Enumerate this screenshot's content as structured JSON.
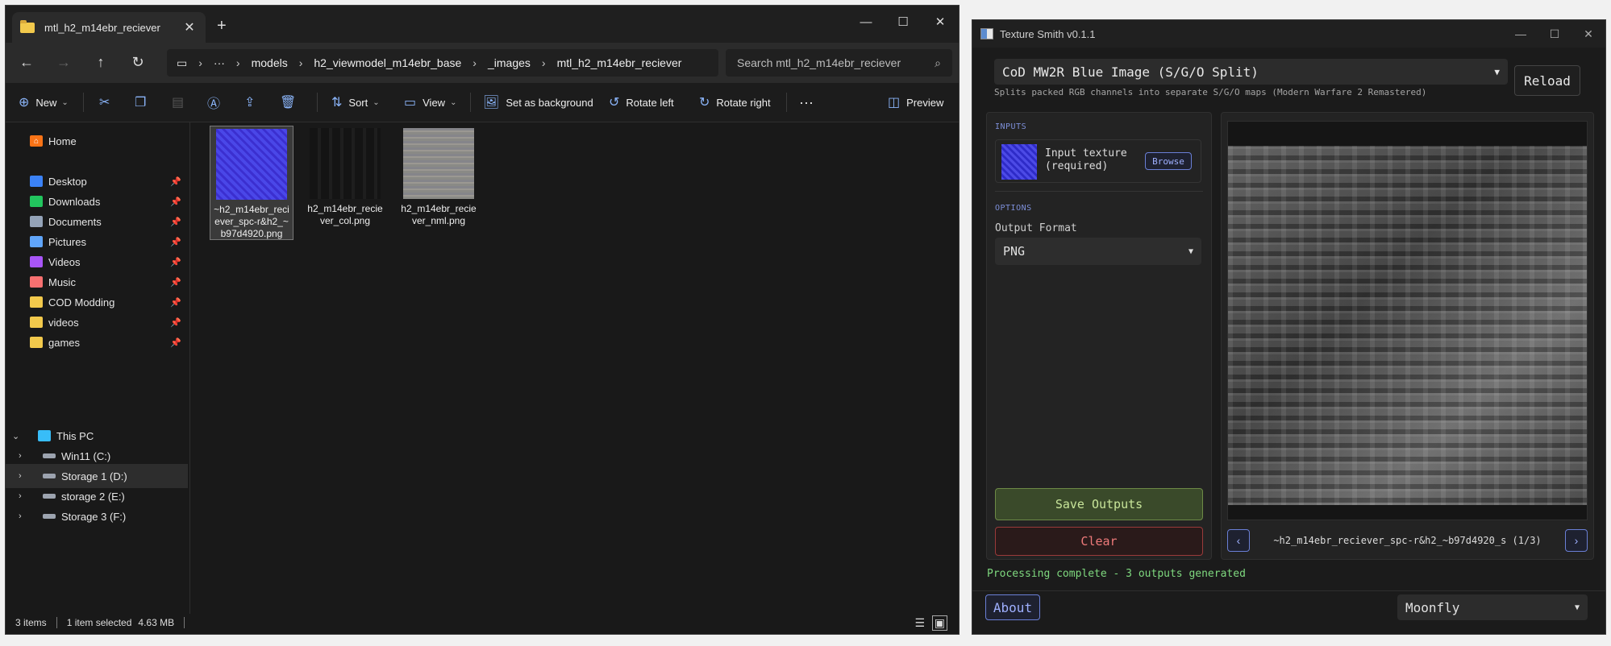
{
  "explorer": {
    "tab_title": "mtl_h2_m14ebr_reciever",
    "new_tab": "+",
    "caption": {
      "minimize": "—",
      "maximize": "☐",
      "close": "✕"
    },
    "breadcrumbs": [
      "models",
      "h2_viewmodel_m14ebr_base",
      "_images",
      "mtl_h2_m14ebr_reciever"
    ],
    "ellipsis": "···",
    "search_placeholder": "Search mtl_h2_m14ebr_reciever",
    "commands": {
      "new": "New",
      "sort": "Sort",
      "view": "View",
      "set_background": "Set as background",
      "rotate_left": "Rotate left",
      "rotate_right": "Rotate right",
      "more": "···",
      "preview": "Preview"
    },
    "sidebar": {
      "home": "Home",
      "quick": [
        {
          "label": "Desktop",
          "icon": "desktop-icon",
          "color": "#3b82f6"
        },
        {
          "label": "Downloads",
          "icon": "download-icon",
          "color": "#22c55e"
        },
        {
          "label": "Documents",
          "icon": "document-icon",
          "color": "#94a3b8"
        },
        {
          "label": "Pictures",
          "icon": "picture-icon",
          "color": "#60a5fa"
        },
        {
          "label": "Videos",
          "icon": "video-icon",
          "color": "#a855f7"
        },
        {
          "label": "Music",
          "icon": "music-icon",
          "color": "#f87171"
        },
        {
          "label": "COD Modding",
          "icon": "folder-icon",
          "color": "#f2c94c"
        },
        {
          "label": "videos",
          "icon": "folder-icon",
          "color": "#f2c94c"
        },
        {
          "label": "games",
          "icon": "folder-icon",
          "color": "#f2c94c"
        }
      ],
      "this_pc": "This PC",
      "drives": [
        "Win11 (C:)",
        "Storage 1 (D:)",
        "storage 2 (E:)",
        "Storage 3 (F:)"
      ]
    },
    "files": [
      {
        "name": "~h2_m14ebr_reciever_spc-r&h2_~b97d4920.png",
        "line1": "~h2_m14ebr_reci",
        "line2": "ever_spc-r&h2_~",
        "line3": "b97d4920.png"
      },
      {
        "name": "h2_m14ebr_reciever_col.png",
        "line1": "h2_m14ebr_recie",
        "line2": "ver_col.png",
        "line3": ""
      },
      {
        "name": "h2_m14ebr_reciever_nml.png",
        "line1": "h2_m14ebr_recie",
        "line2": "ver_nml.png",
        "line3": ""
      }
    ],
    "status": {
      "items": "3 items",
      "selected": "1 item selected",
      "size": "4.63 MB"
    }
  },
  "texture_smith": {
    "title": "Texture Smith v0.1.1",
    "caption": {
      "minimize": "—",
      "maximize": "☐",
      "close": "✕"
    },
    "profile": "CoD MW2R Blue Image (S/G/O Split)",
    "profile_desc": "Splits packed RGB channels into separate S/G/O maps (Modern Warfare 2 Remastered)",
    "reload": "Reload",
    "inputs_title": "INPUTS",
    "input_label_1": "Input texture",
    "input_label_2": "(required)",
    "browse": "Browse",
    "options_title": "OPTIONS",
    "output_format_label": "Output Format",
    "output_format": "PNG",
    "save": "Save Outputs",
    "clear": "Clear",
    "prev": "‹",
    "next": "›",
    "preview_label": "~h2_m14ebr_reciever_spc-r&h2_~b97d4920_s (1/3)",
    "status": "Processing complete - 3 outputs generated",
    "about": "About",
    "theme": "Moonfly"
  },
  "colors": {
    "accent": "#6a7fd6",
    "success": "#7fd97f",
    "danger": "#ee7a7a"
  }
}
